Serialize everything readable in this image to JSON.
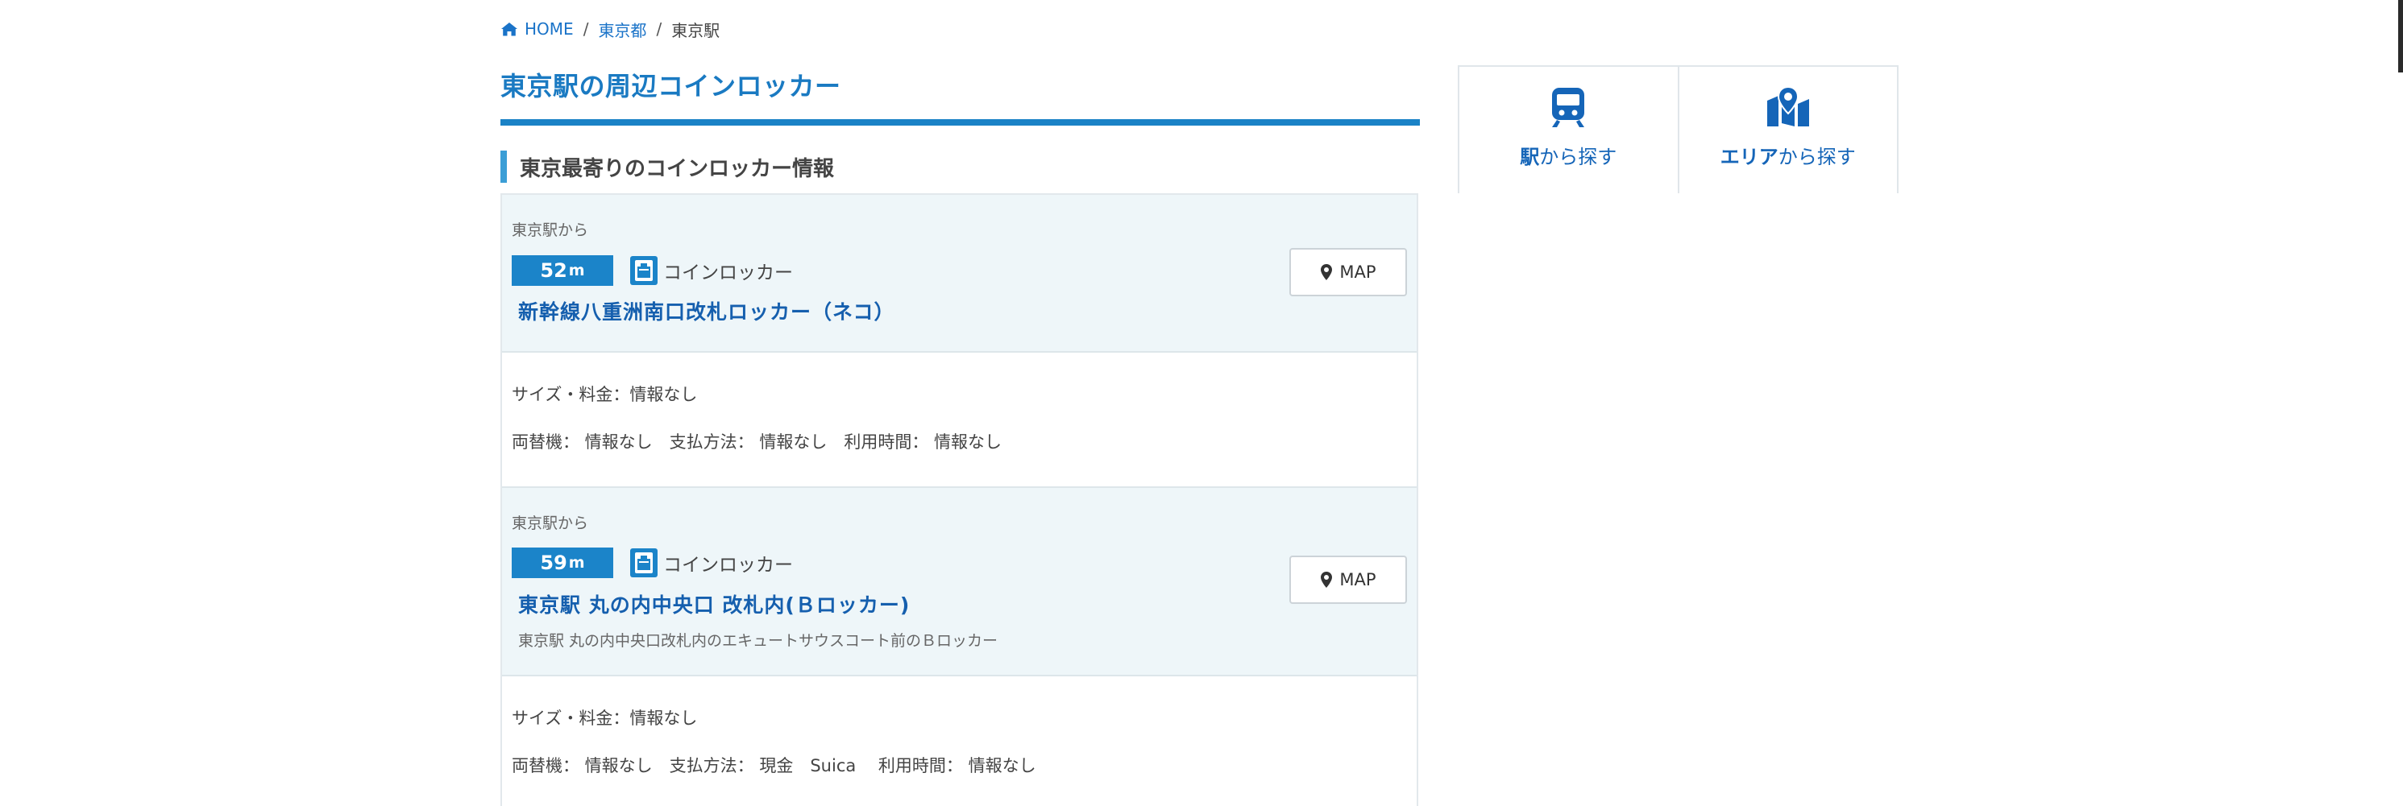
{
  "breadcrumb": {
    "home": "HOME",
    "prefecture": "東京都",
    "current": "東京駅",
    "separator": "/"
  },
  "page_title": "東京駅の周辺コインロッカー",
  "section_title": "東京最寄りのコインロッカー情報",
  "lockers": [
    {
      "from_label": "東京駅から",
      "distance_value": "52",
      "distance_unit": "m",
      "type_label": "コインロッカー",
      "name": "新幹線八重洲南口改札ロッカー（ネコ）",
      "description": "",
      "map_label": "MAP",
      "size_price": "サイズ・料金：情報なし",
      "details": "両替機： 情報なし　支払方法： 情報なし　利用時間： 情報なし"
    },
    {
      "from_label": "東京駅から",
      "distance_value": "59",
      "distance_unit": "m",
      "type_label": "コインロッカー",
      "name": "東京駅 丸の内中央口 改札内(Ｂロッカー)",
      "description": "東京駅 丸の内中央口改札内のエキュートサウスコート前のＢロッカー",
      "map_label": "MAP",
      "size_price": "サイズ・料金：情報なし",
      "details": "両替機： 情報なし　支払方法： 現金　Suica　 利用時間： 情報なし"
    }
  ],
  "side_nav": {
    "station_prefix": "駅",
    "station_suffix": "から探す",
    "area_prefix": "エリア",
    "area_suffix": "から探す"
  },
  "icons": {
    "home": "home-icon",
    "locker": "locker-icon",
    "map_pin": "map-pin-icon",
    "train": "train-icon",
    "area_map": "area-map-icon"
  },
  "colors": {
    "accent": "#1a82c6",
    "title": "#1a7ac2",
    "link": "#1565b8",
    "item_bg": "#eef6f9"
  }
}
